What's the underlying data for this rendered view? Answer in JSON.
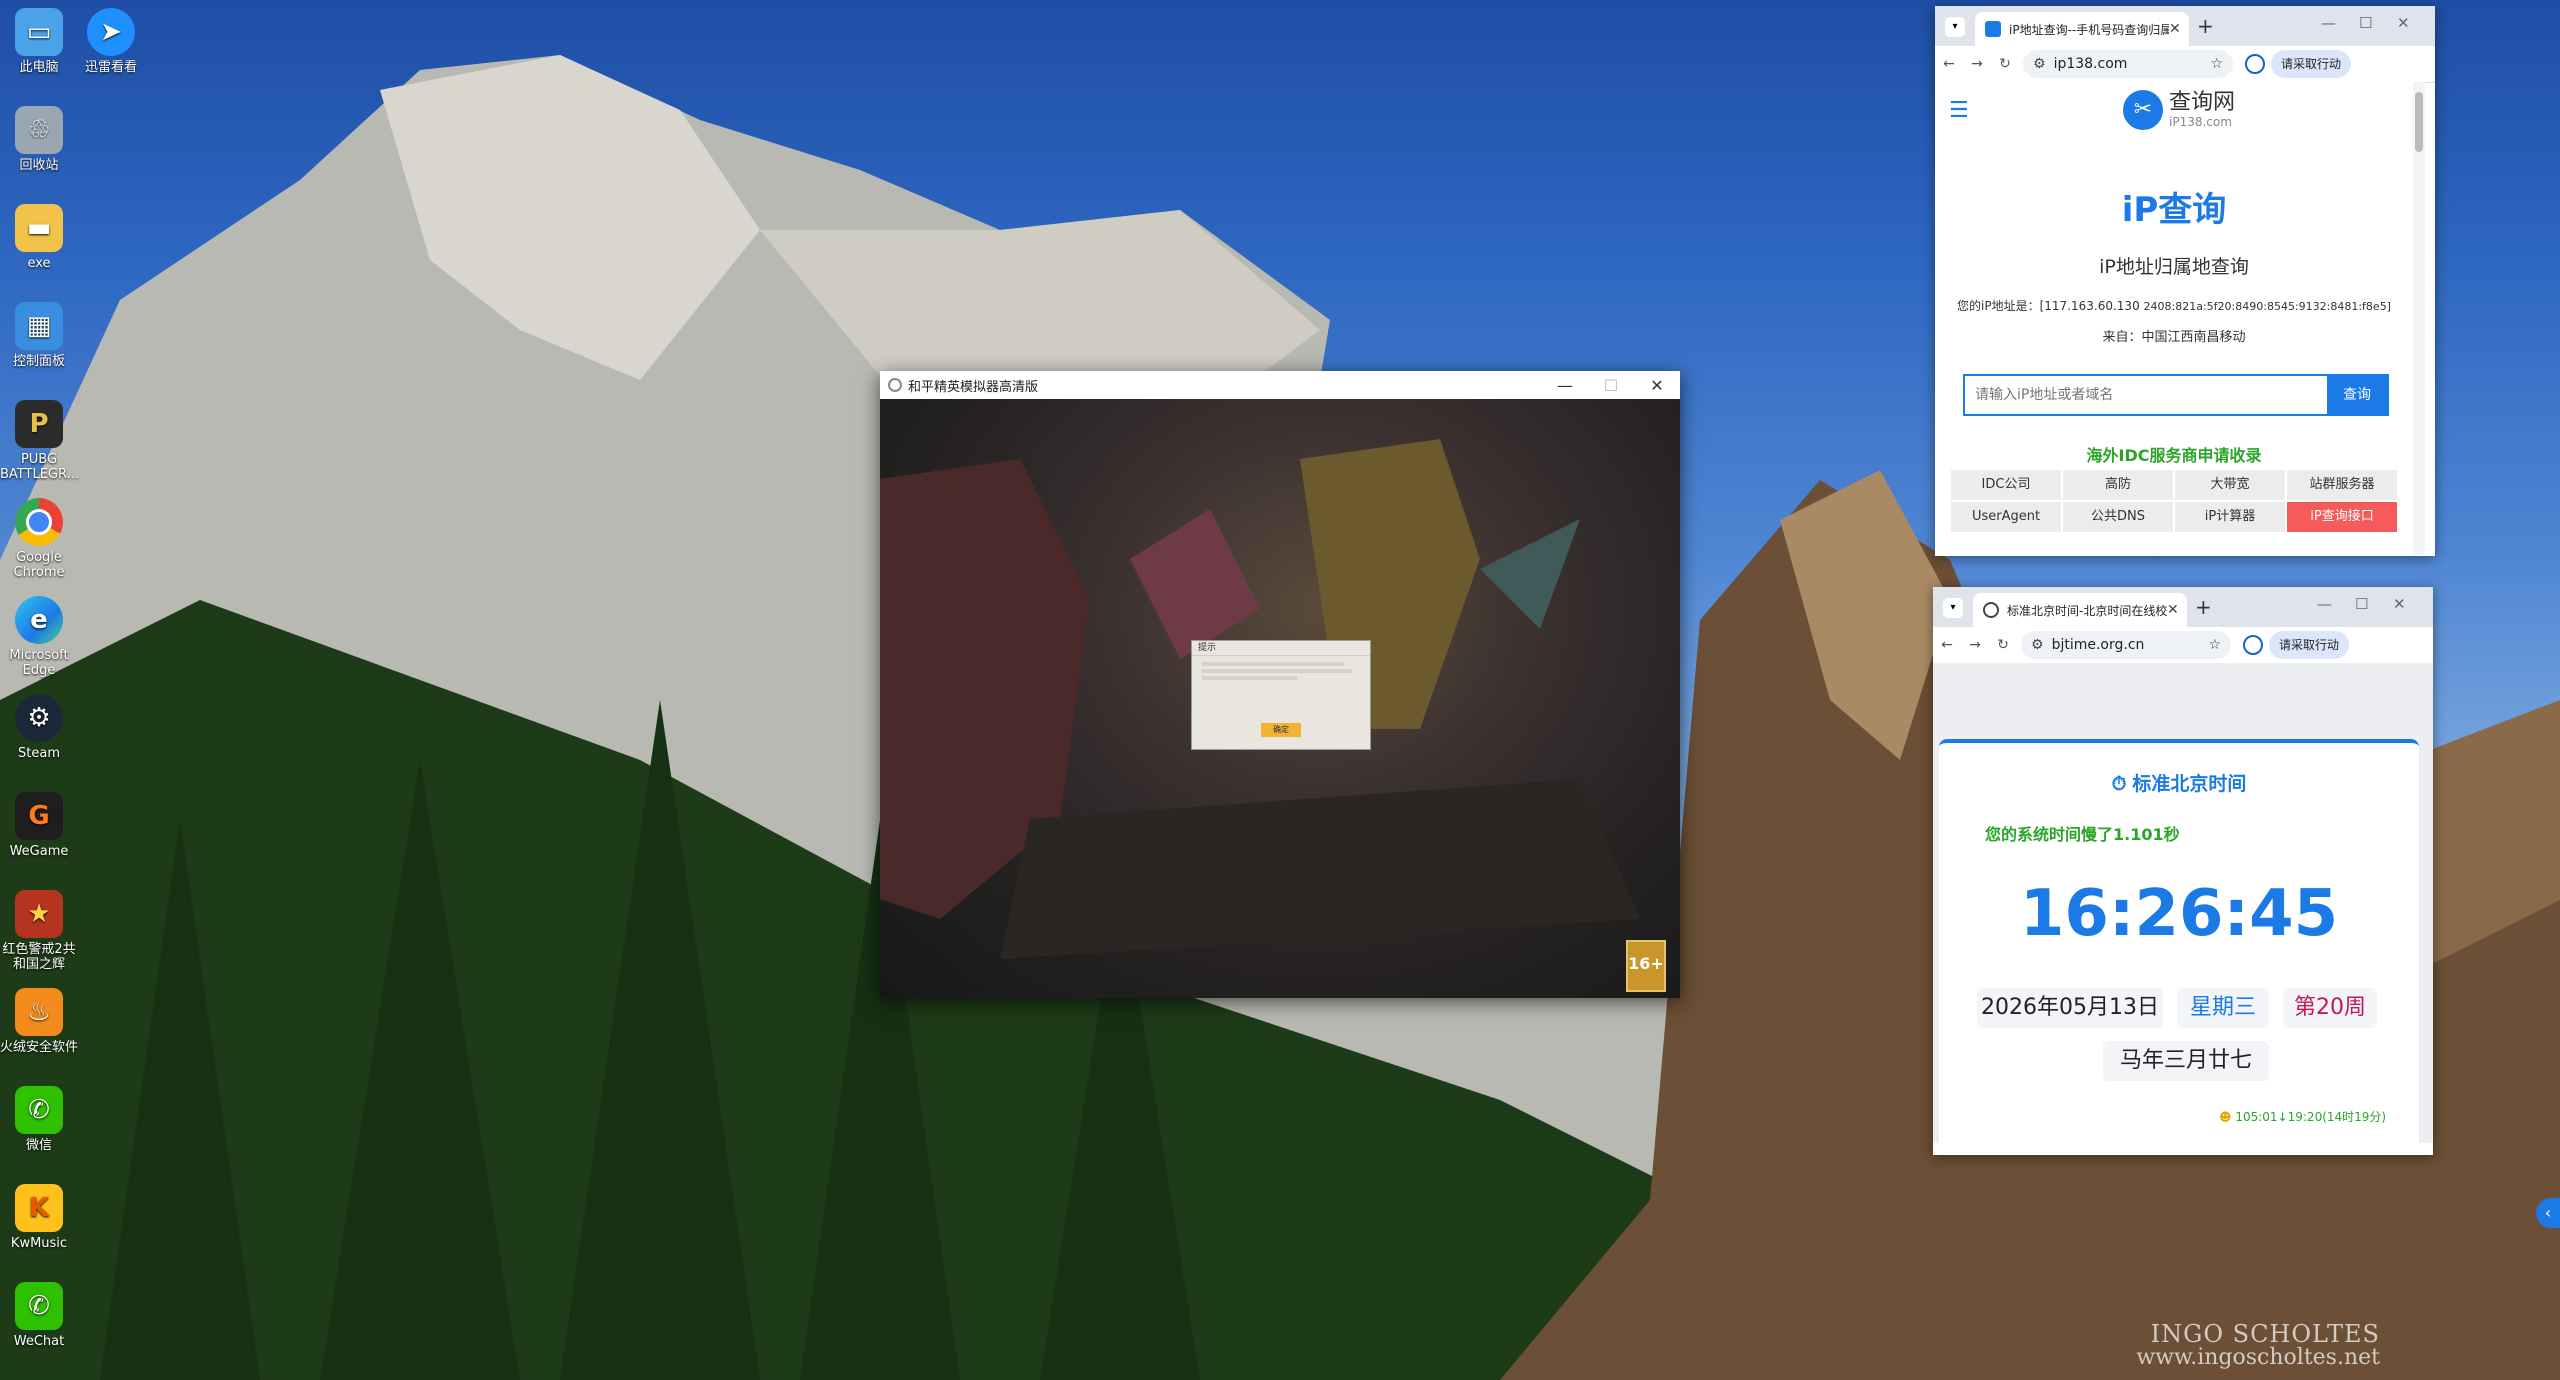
{
  "desktop": {
    "icons": [
      {
        "label": "此电脑",
        "icon": "computer-icon"
      },
      {
        "label": "迅雷看看",
        "icon": "xunlei-icon"
      },
      {
        "label": "回收站",
        "icon": "recycle-bin-icon"
      },
      {
        "label": "exe",
        "icon": "folder-icon"
      },
      {
        "label": "控制面板",
        "icon": "control-panel-icon"
      },
      {
        "label": "PUBG BATTLEGR...",
        "icon": "pubg-icon"
      },
      {
        "label": "Google Chrome",
        "icon": "chrome-icon"
      },
      {
        "label": "Microsoft Edge",
        "icon": "edge-icon"
      },
      {
        "label": "Steam",
        "icon": "steam-icon"
      },
      {
        "label": "WeGame",
        "icon": "wegame-icon"
      },
      {
        "label": "红色警戒2共和国之辉",
        "icon": "red-alert-icon"
      },
      {
        "label": "火绒安全软件",
        "icon": "huorong-icon"
      },
      {
        "label": "微信",
        "icon": "wechat-icon"
      },
      {
        "label": "KwMusic",
        "icon": "kwmusic-icon"
      },
      {
        "label": "WeChat",
        "icon": "wechat-icon"
      }
    ],
    "watermark": {
      "line1": "INGO SCHOLTES",
      "line2": "www.ingoscholtes.net"
    }
  },
  "emulator": {
    "title": "和平精英模拟器高清版",
    "dialog": {
      "title": "提示",
      "ok_label": "确定"
    }
  },
  "ip_window": {
    "tab_title": "iP地址查询--手机号码查询归属",
    "url": "ip138.com",
    "recommend": "请采取行动",
    "brand_name": "查询网",
    "brand_sub": "iP138.com",
    "heading": "iP查询",
    "subheading": "iP地址归属地查询",
    "your_ip_label": "您的iP地址是：",
    "your_ip": "[117.163.60.130",
    "ipv6": "2408:821a:5f20:8490:8545:9132:8481:f8e5]",
    "origin_label": "来自：",
    "origin": "中国江西南昌移动",
    "input_placeholder": "请输入iP地址或者域名",
    "query_label": "查询",
    "idc_title": "海外IDC服务商申请收录",
    "links": [
      "IDC公司",
      "高防",
      "大带宽",
      "站群服务器",
      "UserAgent",
      "公共DNS",
      "iP计算器",
      "iP查询接口"
    ]
  },
  "time_window": {
    "tab_title": "标准北京时间-北京时间在线校",
    "url": "bjtime.org.cn",
    "recommend": "请采取行动",
    "heading": "标准北京时间",
    "status": "您的系统时间慢了1.101秒",
    "time": "16:26:45",
    "date": "2026年05月13日",
    "weekday": "星期三",
    "week": "第20周",
    "lunar": "马年三月廿七",
    "footer": "105:01↓19:20(14时19分)"
  },
  "colors": {
    "accent": "#1b7ae6",
    "green": "#2aa52a",
    "hot": "#f55b5b"
  }
}
